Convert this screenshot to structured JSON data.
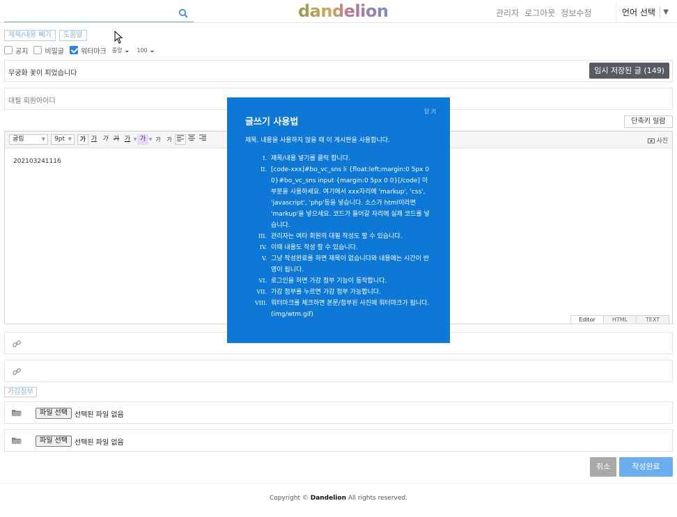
{
  "header": {
    "search_placeholder": "",
    "logo": "dandelion",
    "links": [
      "관리자",
      "로그아웃",
      "정보수정"
    ],
    "language": "언어 선택"
  },
  "toolbar": {
    "toggle_button": "제목/내용 빼기",
    "help_button": "도움말"
  },
  "options": {
    "notice_label": "공지",
    "secret_label": "비밀글",
    "watermark_label": "워터마크",
    "watermark_checked": true,
    "position_value": "중앙",
    "opacity_value": "100"
  },
  "subject": {
    "value": "무궁화 꽃이 피었습니다",
    "temp_button": "임시 저장된 글 (149)"
  },
  "proxy_field": {
    "placeholder": "대필 회원아이디"
  },
  "shortcut_button": "단축키 일람",
  "editor": {
    "font_value": "굴림",
    "size_value": "9pt",
    "tool_buttons": [
      "가",
      "가",
      "가",
      "가",
      "가",
      "가",
      "가",
      "가",
      "가"
    ],
    "photo_label": "사진",
    "content": "202103241116",
    "tabs": [
      "Editor",
      "HTML",
      "TEXT"
    ]
  },
  "attach_label": "가감첨부",
  "files": [
    {
      "button": "파일 선택",
      "status": "선택된 파일 없음"
    },
    {
      "button": "파일 선택",
      "status": "선택된 파일 없음"
    }
  ],
  "actions": {
    "cancel": "취소",
    "submit": "작성완료"
  },
  "footer": {
    "prefix": "Copyright ©",
    "brand": "Dandelion",
    "suffix": "All rights reserved."
  },
  "modal": {
    "close": "닫기",
    "title": "글쓰기 사용법",
    "description": "제목, 내용을 사용하지 않을 때 이 게시판을 사용합니다.",
    "items": [
      {
        "num": "I.",
        "text": "제목/내용 넣기를 클릭 합니다."
      },
      {
        "num": "II.",
        "text": "[code-xxx]#bo_vc_sns li {float:left;margin:0 5px 0 0}#bo_vc_sns input {margin:0 5px 0 0}[/code] 이 부분을 사용하세요. 여기에서 xxx자리에 'markup', 'css', 'javascript', 'php'등을 넣습니다. 소스가 html이라면 'markup'을 넣으세요. 코드가 들어갈 자리에 실제 코드를 넣습니다."
      },
      {
        "num": "III.",
        "text": "관리자는 여타 회원의 대필 작성도 할 수 있습니다."
      },
      {
        "num": "IV.",
        "text": "이때 내용도 작성 할 수 있습니다."
      },
      {
        "num": "V.",
        "text": "그냥 작성완료를 하면 제목이 없습니다와 내용에는 시간이 반영이 됩니다."
      },
      {
        "num": "VI.",
        "text": "로그인을 하면 가감 첨부 기능이 동작합니다."
      },
      {
        "num": "VII.",
        "text": "가감 첨부를 누르면 가감 첨부 가능합니다."
      },
      {
        "num": "VIII.",
        "text": "워터마크를 체크하면 본문/첨부된 사진에 워터마크가 됩니다.(img/wtm.gif)"
      }
    ]
  }
}
